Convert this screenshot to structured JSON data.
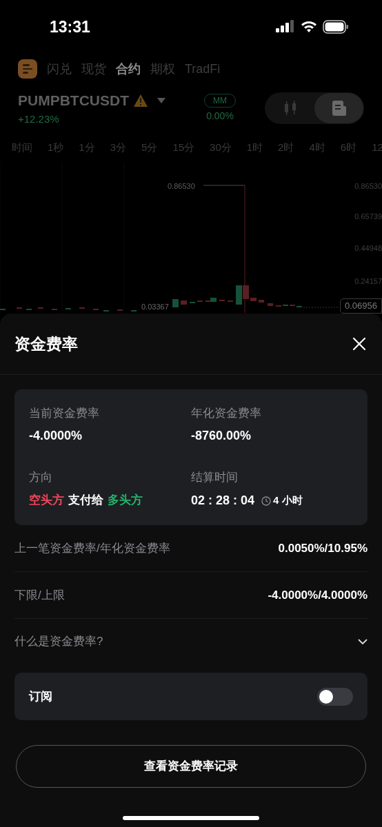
{
  "status_bar": {
    "time": "13:31"
  },
  "top_tabs": [
    {
      "label": "闪兑",
      "selected": false
    },
    {
      "label": "现货",
      "selected": false
    },
    {
      "label": "合约",
      "selected": true
    },
    {
      "label": "期权",
      "selected": false
    },
    {
      "label": "TradFi",
      "selected": false
    }
  ],
  "symbol": {
    "name": "PUMPBTCUSDT",
    "change": "+12.23%",
    "badge": "MM",
    "badge_value": "0.00%"
  },
  "view_toggle": [
    {
      "kind": "chart",
      "selected": false
    },
    {
      "kind": "info",
      "selected": true
    }
  ],
  "intervals": [
    "时间",
    "1秒",
    "1分",
    "3分",
    "5分",
    "15分",
    "30分",
    "1时",
    "2时",
    "4时",
    "6时",
    "12"
  ],
  "chart": {
    "high_label": "0.86530",
    "low_label": "0.03367",
    "price_axis": [
      "0.86530",
      "0.65739",
      "0.44948",
      "0.24157"
    ],
    "last_price": "0.06956"
  },
  "sheet": {
    "title": "资金费率",
    "summary": [
      {
        "label": "当前资金费率",
        "value": "-4.0000%"
      },
      {
        "label": "年化资金费率",
        "value": "-8760.00%"
      }
    ],
    "direction": {
      "label": "方向",
      "from": "空头方",
      "verb": "支付给",
      "to": "多头方"
    },
    "settlement": {
      "label": "结算时间",
      "countdown": "02 : 28 : 04",
      "interval": "4 小时"
    },
    "rows": [
      {
        "label": "上一笔资金费率/年化资金费率",
        "value": "0.0050%/10.95%"
      },
      {
        "label": "下限/上限",
        "value": "-4.0000%/4.0000%"
      }
    ],
    "faq": {
      "label": "什么是资金费率?",
      "expanded": false
    },
    "subscribe": {
      "label": "订阅",
      "on": false
    },
    "history_button": "查看资金费率记录"
  }
}
